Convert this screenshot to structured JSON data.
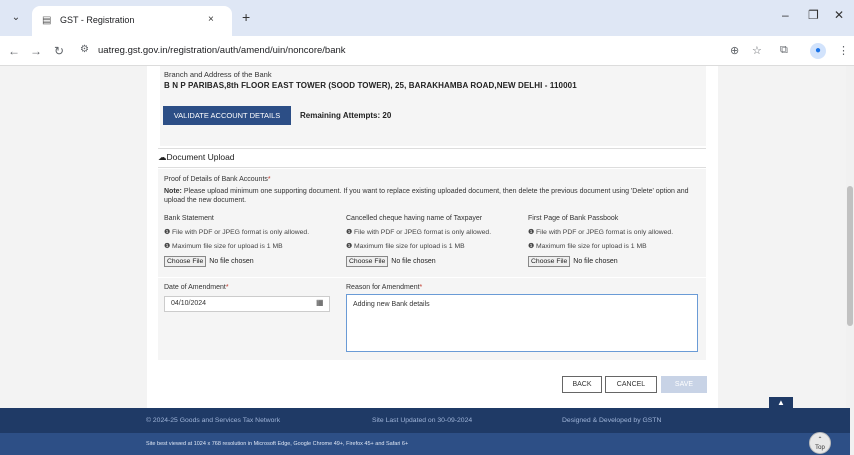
{
  "browser": {
    "tab_title": "GST - Registration",
    "tab_close": "×",
    "new_tab": "+",
    "url": "uatreg.gst.gov.in/registration/auth/amend/uin/noncore/bank",
    "minimize": "–",
    "restore": "❐",
    "close": "✕"
  },
  "bank": {
    "branch_label": "Branch and Address of the Bank",
    "branch_value": "B N P PARIBAS,8th FLOOR EAST TOWER (SOOD TOWER), 25, BARAKHAMBA ROAD,NEW DELHI - 110001",
    "validate_label": "VALIDATE ACCOUNT DETAILS",
    "remaining_label": "Remaining Attempts:",
    "remaining_value": "20"
  },
  "documents": {
    "title": "Document Upload",
    "proof_label": "Proof of Details of Bank Accounts",
    "required_mark": "*",
    "note_label": "Note:",
    "note_text": "Please upload minimum one supporting document. If you want to replace existing uploaded document, then delete the previous document using 'Delete' option and upload the new document.",
    "columns": [
      {
        "heading": "Bank Statement",
        "info1": "File with PDF or JPEG format is only allowed.",
        "info2": "Maximum file size for upload is 1 MB",
        "button": "Choose File",
        "status": "No file chosen"
      },
      {
        "heading": "Cancelled cheque having name of Taxpayer",
        "info1": "File with PDF or JPEG format is only allowed.",
        "info2": "Maximum file size for upload is 1 MB",
        "button": "Choose File",
        "status": "No file chosen"
      },
      {
        "heading": "First Page of Bank Passbook",
        "info1": "File with PDF or JPEG format is only allowed.",
        "info2": "Maximum file size for upload is 1 MB",
        "button": "Choose File",
        "status": "No file chosen"
      }
    ]
  },
  "amendment": {
    "date_label": "Date of Amendment",
    "date_value": "04/10/2024",
    "reason_label": "Reason for Amendment",
    "reason_value": "Adding new Bank details"
  },
  "actions": {
    "back": "BACK",
    "cancel": "CANCEL",
    "save": "SAVE"
  },
  "footer": {
    "copyright": "© 2024-25 Goods and Services Tax Network",
    "updated": "Site Last Updated on 30-09-2024",
    "designed": "Designed & Developed by GSTN",
    "best_viewed": "Site best viewed at 1024 x 768 resolution in Microsoft Edge, Google Chrome 49+, Firefox 45+ and Safari 6+",
    "top_label": "Top"
  },
  "colors": {
    "primary": "#2c4e86",
    "footer_dark": "#1f3a66",
    "required": "#c0392b"
  }
}
